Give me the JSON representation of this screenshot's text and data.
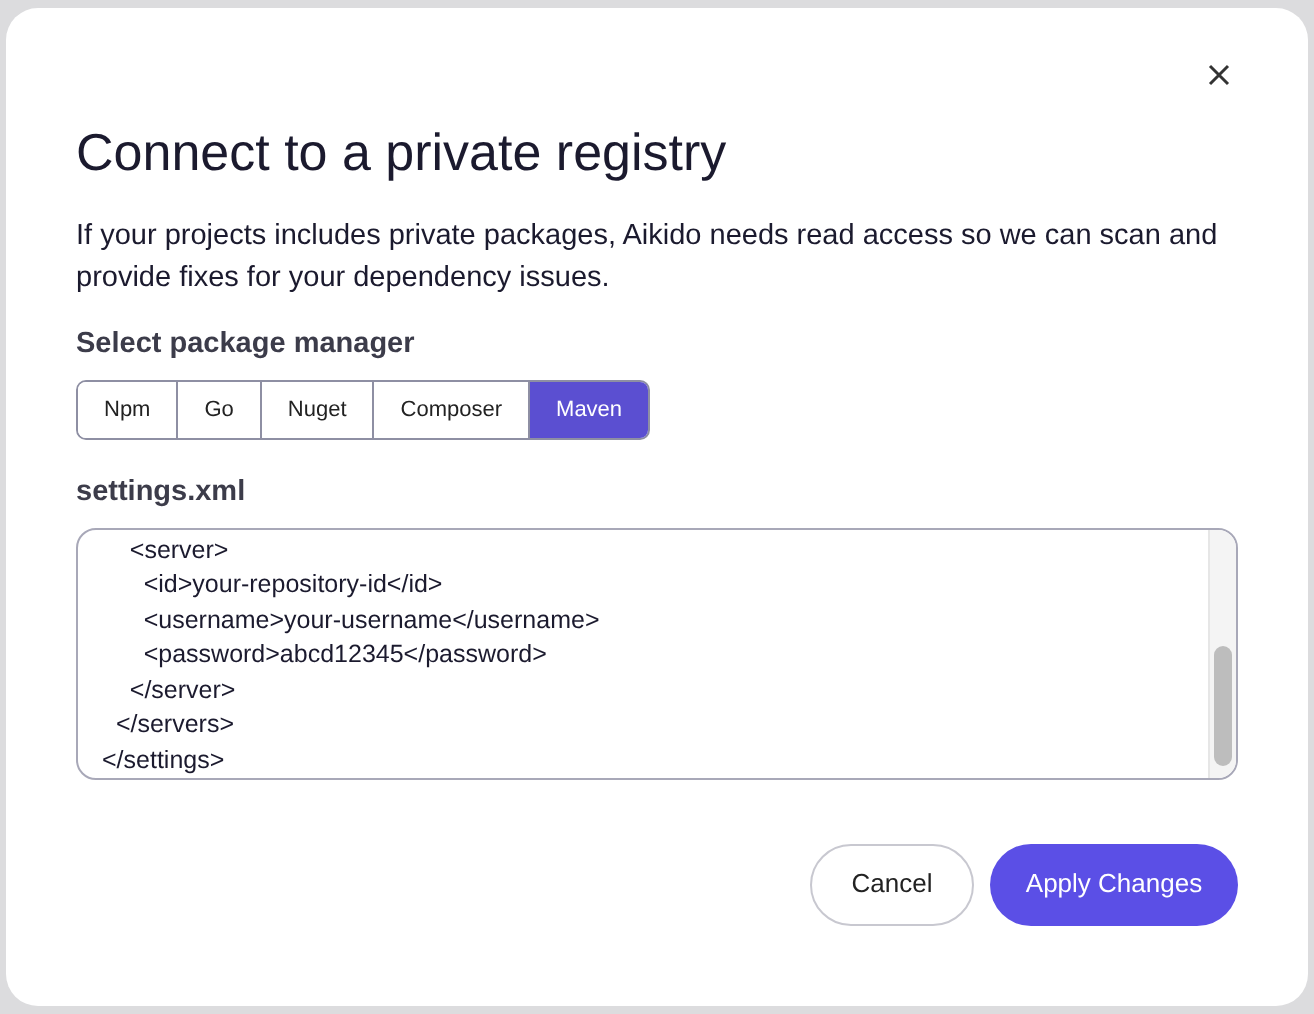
{
  "dialog": {
    "title": "Connect to a private registry",
    "description": "If your projects includes private packages, Aikido needs read access so we can scan and provide fixes for your dependency issues.",
    "package_label": "Select package manager",
    "package_managers": [
      {
        "label": "Npm",
        "selected": false
      },
      {
        "label": "Go",
        "selected": false
      },
      {
        "label": "Nuget",
        "selected": false
      },
      {
        "label": "Composer",
        "selected": false
      },
      {
        "label": "Maven",
        "selected": true
      }
    ],
    "file_label": "settings.xml",
    "code_lines": [
      "    <server>",
      "      <id>your-repository-id</id>",
      "      <username>your-username</username>",
      "      <password>abcd12345</password>",
      "    </server>",
      "  </servers>",
      "</settings>"
    ],
    "buttons": [
      {
        "label": "Cancel",
        "kind": "secondary"
      },
      {
        "label": "Apply Changes",
        "kind": "primary"
      }
    ]
  }
}
